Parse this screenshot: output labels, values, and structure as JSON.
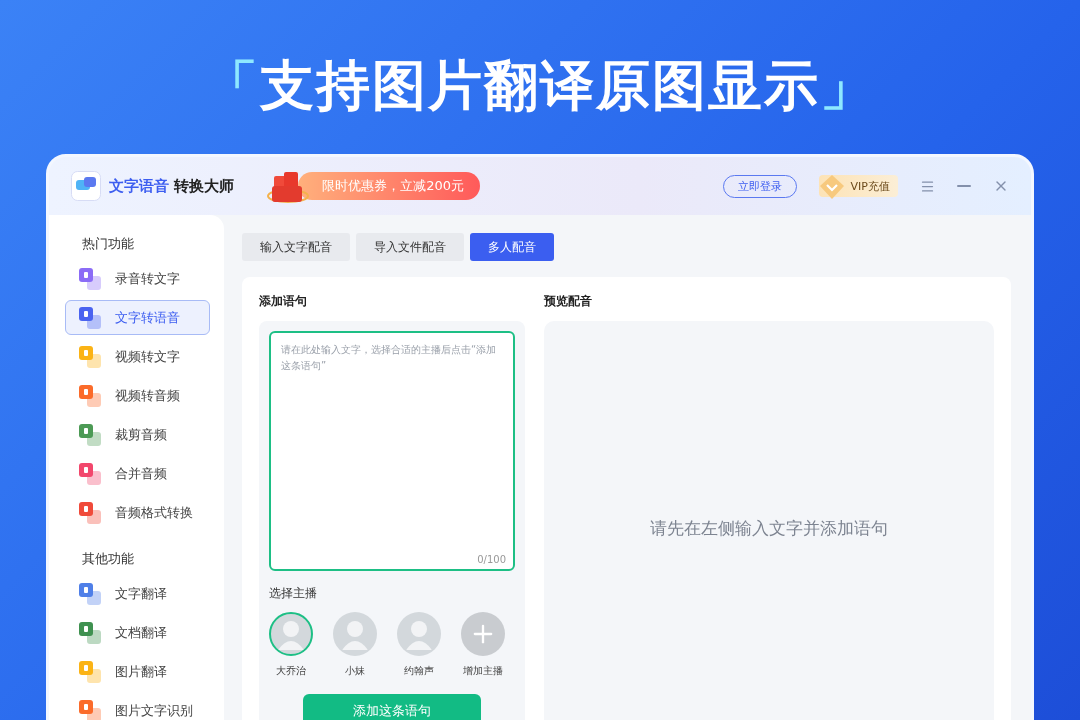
{
  "headline": {
    "open": "「",
    "text": "支持图片翻译原图显示",
    "close": "」"
  },
  "app": {
    "name_highlight": "文字语音",
    "name_rest": "转换大师"
  },
  "promo": "限时优惠券，立减200元",
  "login": "立即登录",
  "vip": "VIP充值",
  "sidebar": [
    {
      "title": "热门功能",
      "items": [
        {
          "label": "录音转文字",
          "selected": false,
          "color": "#8b6cf6"
        },
        {
          "label": "文字转语音",
          "selected": true,
          "color": "#4a63f0"
        },
        {
          "label": "视频转文字",
          "selected": false,
          "color": "#fbb315"
        },
        {
          "label": "视频转音频",
          "selected": false,
          "color": "#fb6b2a"
        },
        {
          "label": "裁剪音频",
          "selected": false,
          "color": "#4c9a55"
        },
        {
          "label": "合并音频",
          "selected": false,
          "color": "#f2476c"
        },
        {
          "label": "音频格式转换",
          "selected": false,
          "color": "#f04a3a"
        }
      ]
    },
    {
      "title": "其他功能",
      "items": [
        {
          "label": "文字翻译",
          "selected": false,
          "color": "#4f7fe8"
        },
        {
          "label": "文档翻译",
          "selected": false,
          "color": "#3f9150"
        },
        {
          "label": "图片翻译",
          "selected": false,
          "color": "#fbb315"
        },
        {
          "label": "图片文字识别",
          "selected": false,
          "color": "#fb6b2a"
        }
      ]
    }
  ],
  "tabs": [
    {
      "label": "输入文字配音",
      "selected": false
    },
    {
      "label": "导入文件配音",
      "selected": false
    },
    {
      "label": "多人配音",
      "selected": true
    }
  ],
  "add_section": {
    "title": "添加语句",
    "placeholder": "请在此处输入文字，选择合适的主播后点击“添加这条语句”",
    "counter": "0/100",
    "voice_title": "选择主播",
    "voices": [
      {
        "kind": "voice",
        "name": "大乔治",
        "selected": true
      },
      {
        "kind": "voice",
        "name": "小妹",
        "selected": false
      },
      {
        "kind": "voice",
        "name": "约翰声",
        "selected": false
      },
      {
        "kind": "add",
        "name": "增加主播",
        "selected": false
      }
    ],
    "button": "添加这条语句"
  },
  "preview": {
    "title": "预览配音",
    "empty": "请先在左侧输入文字并添加语句"
  }
}
